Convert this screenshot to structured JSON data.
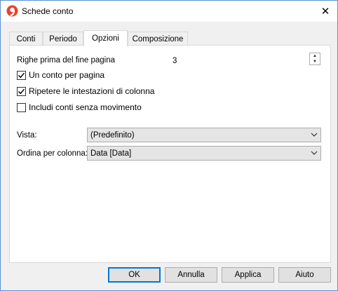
{
  "window": {
    "title": "Schede conto",
    "close_glyph": "✕"
  },
  "tabs": [
    {
      "label": "Conti",
      "active": false
    },
    {
      "label": "Periodo",
      "active": false
    },
    {
      "label": "Opzioni",
      "active": true
    },
    {
      "label": "Composizione",
      "active": false
    }
  ],
  "options": {
    "rows_before_page_end": {
      "label": "Righe prima del fine pagina",
      "value": "3"
    },
    "checkboxes": [
      {
        "label": "Un conto per pagina",
        "checked": true
      },
      {
        "label": "Ripetere le intestazioni di colonna",
        "checked": true
      },
      {
        "label": "Includi conti senza movimento",
        "checked": false
      }
    ],
    "view": {
      "label": "Vista:",
      "value": "(Predefinito)"
    },
    "sort": {
      "label": "Ordina per colonna:",
      "value": "Data [Data]"
    }
  },
  "buttons": {
    "ok": "OK",
    "cancel": "Annulla",
    "apply": "Applica",
    "help": "Aiuto"
  },
  "colors": {
    "accent": "#0078d7",
    "logo": "#e8412c"
  },
  "icons": {
    "app": "banana-app-icon",
    "close": "close-icon",
    "spin": "spin-arrows-icon",
    "dropdown": "chevron-down-icon",
    "check": "checkmark-icon"
  }
}
